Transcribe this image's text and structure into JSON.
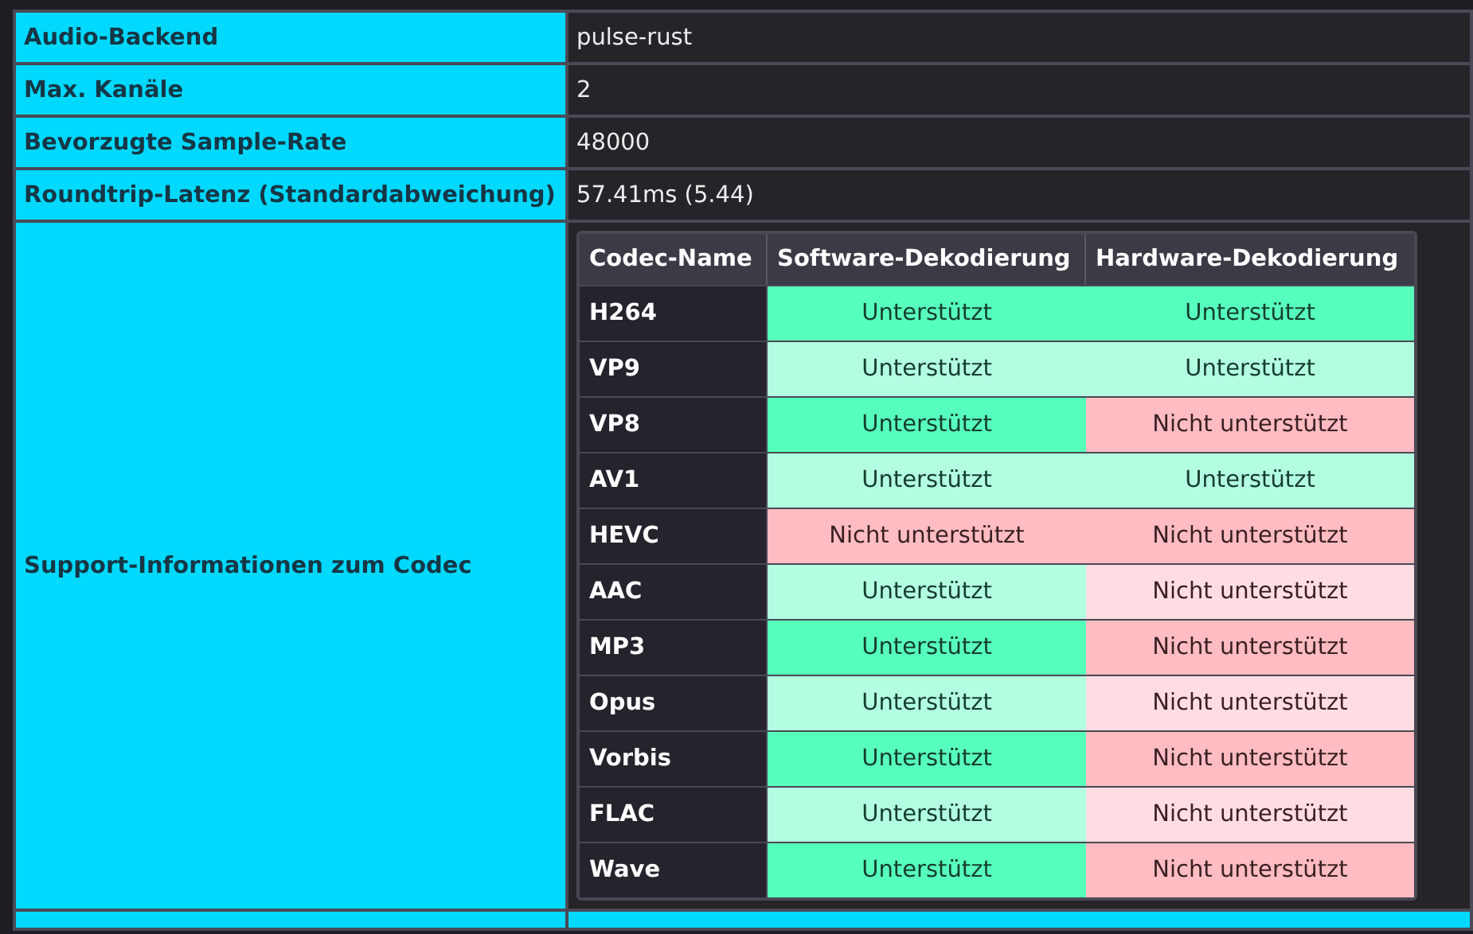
{
  "info_rows": [
    {
      "label": "Audio-Backend",
      "value": "pulse-rust"
    },
    {
      "label": "Max. Kanäle",
      "value": "2"
    },
    {
      "label": "Bevorzugte Sample-Rate",
      "value": "48000"
    },
    {
      "label": "Roundtrip-Latenz (Standardabweichung)",
      "value": "57.41ms (5.44)"
    }
  ],
  "codec_support": {
    "label": "Support-Informationen zum Codec",
    "columns": [
      "Codec-Name",
      "Software-Dekodierung",
      "Hardware-Dekodierung"
    ],
    "rows": [
      {
        "name": "H264",
        "software": {
          "text": "Unterstützt",
          "supported": true
        },
        "hardware": {
          "text": "Unterstützt",
          "supported": true
        }
      },
      {
        "name": "VP9",
        "software": {
          "text": "Unterstützt",
          "supported": true
        },
        "hardware": {
          "text": "Unterstützt",
          "supported": true
        }
      },
      {
        "name": "VP8",
        "software": {
          "text": "Unterstützt",
          "supported": true
        },
        "hardware": {
          "text": "Nicht unterstützt",
          "supported": false
        }
      },
      {
        "name": "AV1",
        "software": {
          "text": "Unterstützt",
          "supported": true
        },
        "hardware": {
          "text": "Unterstützt",
          "supported": true
        }
      },
      {
        "name": "HEVC",
        "software": {
          "text": "Nicht unterstützt",
          "supported": false
        },
        "hardware": {
          "text": "Nicht unterstützt",
          "supported": false
        }
      },
      {
        "name": "AAC",
        "software": {
          "text": "Unterstützt",
          "supported": true
        },
        "hardware": {
          "text": "Nicht unterstützt",
          "supported": false
        }
      },
      {
        "name": "MP3",
        "software": {
          "text": "Unterstützt",
          "supported": true
        },
        "hardware": {
          "text": "Nicht unterstützt",
          "supported": false
        }
      },
      {
        "name": "Opus",
        "software": {
          "text": "Unterstützt",
          "supported": true
        },
        "hardware": {
          "text": "Nicht unterstützt",
          "supported": false
        }
      },
      {
        "name": "Vorbis",
        "software": {
          "text": "Unterstützt",
          "supported": true
        },
        "hardware": {
          "text": "Nicht unterstützt",
          "supported": false
        }
      },
      {
        "name": "FLAC",
        "software": {
          "text": "Unterstützt",
          "supported": true
        },
        "hardware": {
          "text": "Nicht unterstützt",
          "supported": false
        }
      },
      {
        "name": "Wave",
        "software": {
          "text": "Unterstützt",
          "supported": true
        },
        "hardware": {
          "text": "Nicht unterstützt",
          "supported": false
        }
      }
    ]
  }
}
